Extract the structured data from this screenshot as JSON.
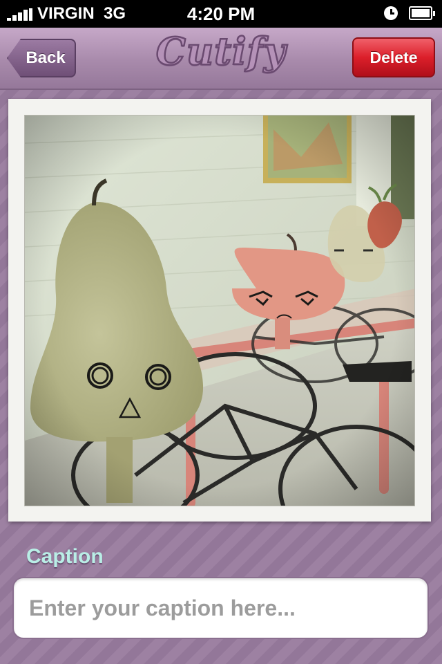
{
  "status_bar": {
    "carrier": "VIRGIN",
    "network": "3G",
    "time": "4:20 PM",
    "icons": [
      "signal-icon",
      "clock-icon",
      "battery-icon"
    ]
  },
  "nav": {
    "back_label": "Back",
    "logo_text": "Cutify",
    "delete_label": "Delete"
  },
  "photo": {
    "description_icons": [
      "pear-sticker",
      "tomato-sticker",
      "radish-sticker"
    ]
  },
  "caption": {
    "label": "Caption",
    "placeholder": "Enter your caption here...",
    "value": ""
  },
  "colors": {
    "accent_caption": "#b9eee6",
    "delete_red": "#dc1f2a",
    "nav_purple": "#a88aab"
  }
}
